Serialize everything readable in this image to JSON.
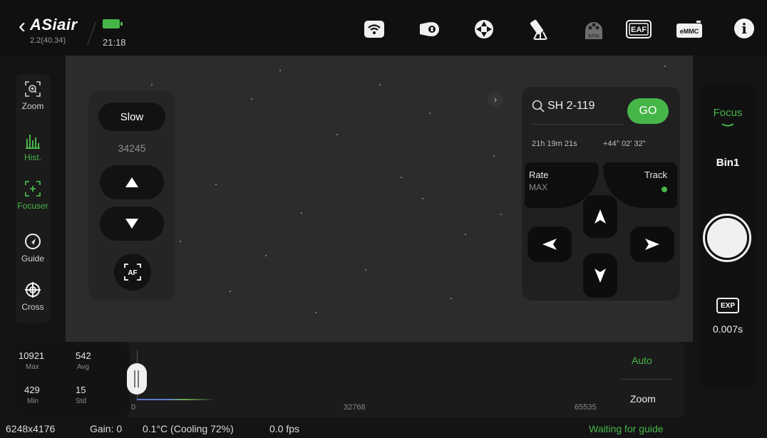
{
  "header": {
    "app_logo": "ASiair",
    "version": "2.2(40.34)",
    "time": "21:18",
    "icons": [
      "wifi-icon",
      "camera-icon",
      "guide-scope-icon",
      "telescope-icon",
      "efw-icon",
      "eaf-icon",
      "emmc-icon",
      "info-icon"
    ],
    "efw_label": "EFW",
    "eaf_label": "EAF",
    "emmc_label": "eMMC",
    "info_label": "i"
  },
  "left_tools": {
    "zoom": "Zoom",
    "hist": "Hist.",
    "focuser": "Focuser",
    "guide": "Guide",
    "cross": "Cross"
  },
  "focuser": {
    "speed_label": "Slow",
    "position": "34245",
    "af_label": "AF"
  },
  "mount": {
    "target_name": "SH 2-119",
    "go_label": "GO",
    "ra": "21h 19m 21s",
    "dec": "+44° 02' 32\"",
    "rate_label": "Rate",
    "rate_value": "MAX",
    "track_label": "Track"
  },
  "right_panel": {
    "mode": "Focus",
    "bin": "Bin1",
    "exp_label": "EXP",
    "exposure": "0.007s"
  },
  "histogram": {
    "max_value": "10921",
    "max_label": "Max",
    "avg_value": "542",
    "avg_label": "Avg",
    "min_value": "429",
    "min_label": "Min",
    "std_value": "15",
    "std_label": "Std",
    "axis_start": "0",
    "axis_mid": "32768",
    "axis_end": "65535",
    "auto_label": "Auto",
    "zoom_label": "Zoom"
  },
  "status": {
    "resolution": "6248x4176",
    "gain": "Gain: 0",
    "temp": "0.1°C (Cooling 72%)",
    "fps": "0.0 fps",
    "guide_status": "Waiting for guide"
  },
  "colors": {
    "accent": "#47b649",
    "background": "#141414"
  }
}
